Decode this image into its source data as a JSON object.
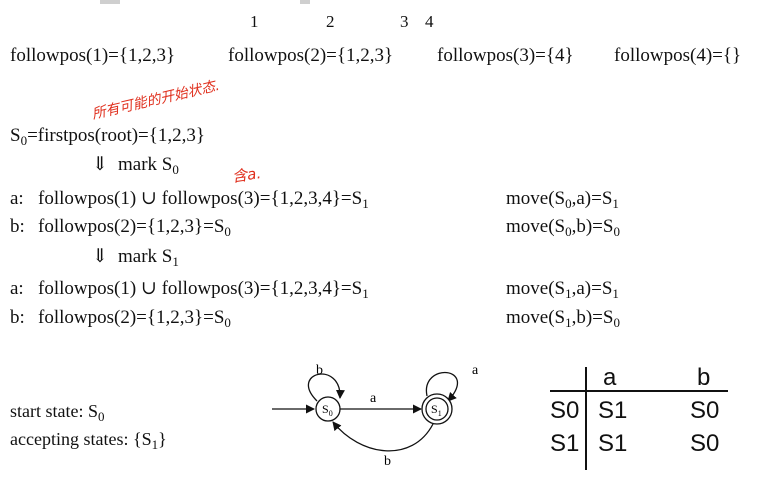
{
  "indices": [
    "1",
    "2",
    "3",
    "4"
  ],
  "followpos": [
    "followpos(1)={1,2,3}",
    "followpos(2)={1,2,3}",
    "followpos(3)={4}",
    "followpos(4)={}"
  ],
  "annotation_top": "所有可能的开始状态.",
  "annotation_a": "含a.",
  "s0_line": {
    "pre": "S",
    "sub": "0",
    "post": "=firstpos(root)={1,2,3}"
  },
  "mark_arrow": "⇓",
  "mark0": {
    "pre": "mark S",
    "sub": "0"
  },
  "row_a0": {
    "label": "a:",
    "text": "followpos(1) ∪ followpos(3)={1,2,3,4}=S",
    "sub": "1"
  },
  "move_a0": {
    "pre": "move(S",
    "sub1": "0",
    "mid": ",a)=S",
    "sub2": "1"
  },
  "row_b0": {
    "label": "b:",
    "text": "followpos(2)={1,2,3}=S",
    "sub": "0"
  },
  "move_b0": {
    "pre": "move(S",
    "sub1": "0",
    "mid": ",b)=S",
    "sub2": "0"
  },
  "mark1": {
    "pre": "mark S",
    "sub": "1"
  },
  "row_a1": {
    "label": "a:",
    "text": "followpos(1) ∪ followpos(3)={1,2,3,4}=S",
    "sub": "1"
  },
  "move_a1": {
    "pre": "move(S",
    "sub1": "1",
    "mid": ",a)=S",
    "sub2": "1"
  },
  "row_b1": {
    "label": "b:",
    "text": "followpos(2)={1,2,3}=S",
    "sub": "0"
  },
  "move_b1": {
    "pre": "move(S",
    "sub1": "1",
    "mid": ",b)=S",
    "sub2": "0"
  },
  "start_state": {
    "pre": "start state: S",
    "sub": "0"
  },
  "accepting": {
    "pre": "accepting states: {S",
    "sub": "1",
    "post": "}"
  },
  "dfa": {
    "s0": "S",
    "s0_sub": "0",
    "s1": "S",
    "s1_sub": "1",
    "edge_a": "a",
    "edge_b": "b",
    "loop_s0": "b",
    "loop_s1": "a"
  },
  "table": {
    "headers": [
      "a",
      "b"
    ],
    "rows": [
      {
        "state": "S0",
        "a": "S1",
        "b": "S0"
      },
      {
        "state": "S1",
        "a": "S1",
        "b": "S0"
      }
    ]
  }
}
